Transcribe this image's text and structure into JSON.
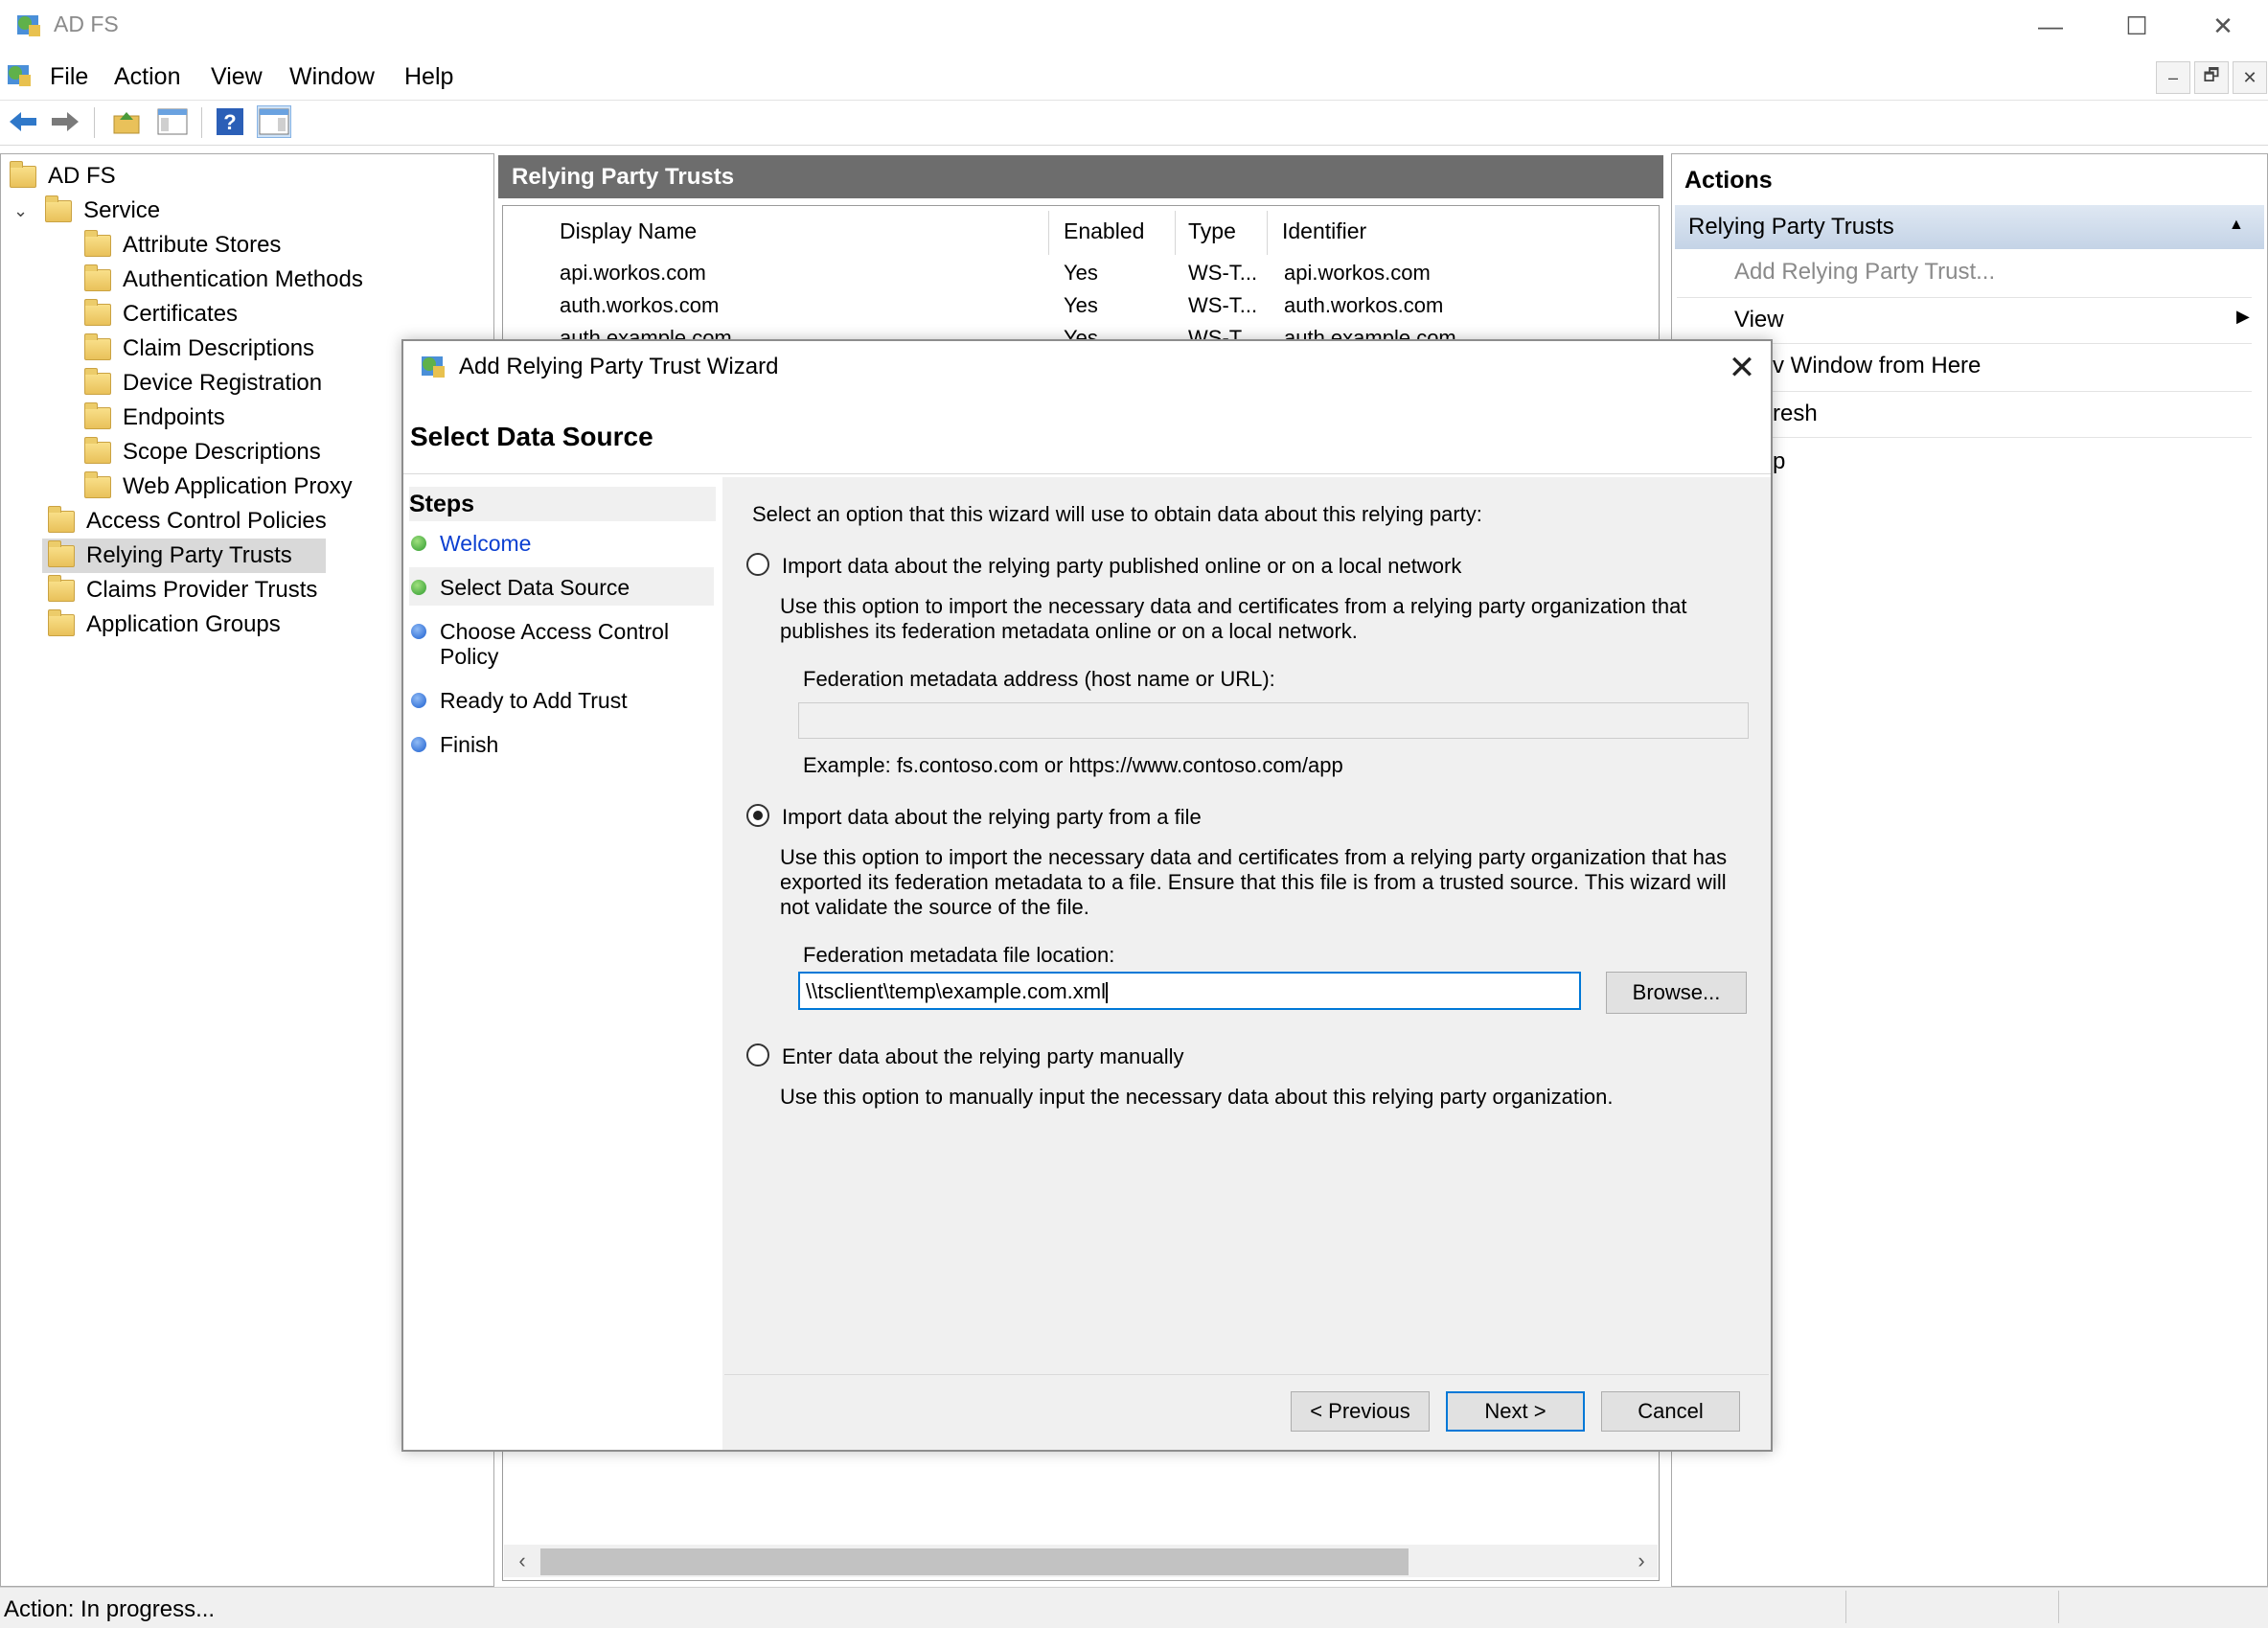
{
  "window": {
    "title": "AD FS",
    "minimize": "—",
    "maximize": "☐",
    "close": "✕"
  },
  "menu": [
    "File",
    "Action",
    "View",
    "Window",
    "Help"
  ],
  "mdi": {
    "minimize": "–",
    "restore": "🗗",
    "close": "✕"
  },
  "tree": {
    "root": "AD FS",
    "service": "Service",
    "service_children": [
      "Attribute Stores",
      "Authentication Methods",
      "Certificates",
      "Claim Descriptions",
      "Device Registration",
      "Endpoints",
      "Scope Descriptions",
      "Web Application Proxy"
    ],
    "others": [
      "Access Control Policies",
      "Relying Party Trusts",
      "Claims Provider Trusts",
      "Application Groups"
    ],
    "selected": "Relying Party Trusts"
  },
  "center": {
    "title": "Relying Party Trusts",
    "columns": [
      "Display Name",
      "Enabled",
      "Type",
      "Identifier"
    ],
    "rows": [
      [
        "api.workos.com",
        "Yes",
        "WS-T...",
        "api.workos.com"
      ],
      [
        "auth.workos.com",
        "Yes",
        "WS-T...",
        "auth.workos.com"
      ],
      [
        "auth.example.com",
        "Yes",
        "WS-T...",
        "auth.example.com"
      ]
    ]
  },
  "actions": {
    "title": "Actions",
    "section": "Relying Party Trusts",
    "items": [
      "Add Relying Party Trust...",
      "View",
      "v Window from Here",
      "resh",
      "p"
    ]
  },
  "status": {
    "text": "Action:  In progress..."
  },
  "dialog": {
    "title": "Add Relying Party Trust Wizard",
    "heading": "Select Data Source",
    "steps_title": "Steps",
    "steps": [
      {
        "label": "Welcome",
        "state": "done"
      },
      {
        "label": "Select Data Source",
        "state": "current"
      },
      {
        "label": "Choose Access Control Policy",
        "state": "pending"
      },
      {
        "label": "Ready to Add Trust",
        "state": "pending"
      },
      {
        "label": "Finish",
        "state": "pending"
      }
    ],
    "intro": "Select an option that this wizard will use to obtain data about this relying party:",
    "option_online": {
      "label": "Import data about the relying party published online or on a local network",
      "desc": "Use this option to import the necessary data and certificates from a relying party organization that publishes its federation metadata online or on a local network.",
      "field_label": "Federation metadata address (host name or URL):",
      "field_value": "",
      "example": "Example: fs.contoso.com or https://www.contoso.com/app"
    },
    "option_file": {
      "label": "Import data about the relying party from a file",
      "desc": "Use this option to import the necessary data and certificates from a relying party organization that has exported its federation metadata to a file. Ensure that this file is from a trusted source.  This wizard will not validate the source of the file.",
      "field_label": "Federation metadata file location:",
      "field_value": "\\\\tsclient\\temp\\example.com.xml",
      "browse": "Browse..."
    },
    "option_manual": {
      "label": "Enter data about the relying party manually",
      "desc": "Use this option to manually input the necessary data about this relying party organization."
    },
    "selected_option": "file",
    "buttons": {
      "previous": "< Previous",
      "next": "Next >",
      "cancel": "Cancel"
    }
  }
}
